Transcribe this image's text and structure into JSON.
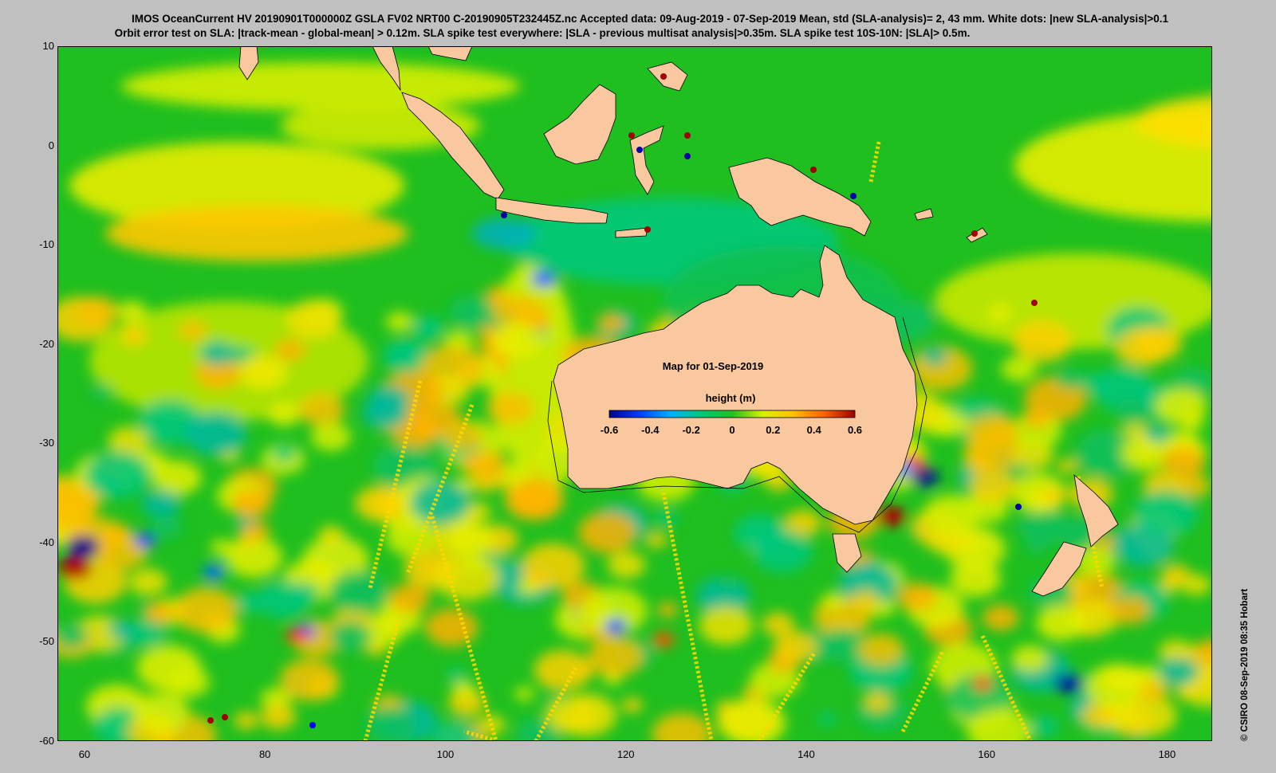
{
  "title_line1": "IMOS OceanCurrent HV 20190901T000000Z GSLA FV02 NRT00 C-20190905T232445Z.nc  Accepted data: 09-Aug-2019 - 07-Sep-2019 Mean, std (SLA-analysis)= 2, 43 mm. White dots: |new SLA-analysis|>0.1",
  "title_line2": "Orbit error test on SLA: |track-mean  - global-mean| > 0.12m.  SLA spike test everywhere: |SLA - previous multisat analysis|>0.35m. SLA spike test 10S-10N: |SLA|> 0.5m.",
  "map_date_label": "Map for 01-Sep-2019",
  "colorbar": {
    "label": "height (m)",
    "ticks": [
      "-0.6",
      "-0.4",
      "-0.2",
      "0",
      "0.2",
      "0.4",
      "0.6"
    ],
    "range": [
      -0.6,
      0.6
    ],
    "colors": [
      "#00008b",
      "#0040ff",
      "#00b0ff",
      "#00c878",
      "#20c020",
      "#d8f000",
      "#ffc000",
      "#ff6000",
      "#a00000"
    ]
  },
  "axes": {
    "lat_ticks": [
      "10",
      "0",
      "-10",
      "-20",
      "-30",
      "-40",
      "-50",
      "-60"
    ],
    "lon_ticks": [
      "60",
      "80",
      "100",
      "120",
      "140",
      "160",
      "180"
    ],
    "lon_range": [
      57,
      185
    ],
    "lat_range": [
      -60,
      10
    ]
  },
  "colors": {
    "land": "#f9c89f",
    "ocean_base": "#1fbf1f",
    "background": "#c0c0c0"
  },
  "credit": "© CSIRO 08-Sep-2019 08:35 Hobart"
}
